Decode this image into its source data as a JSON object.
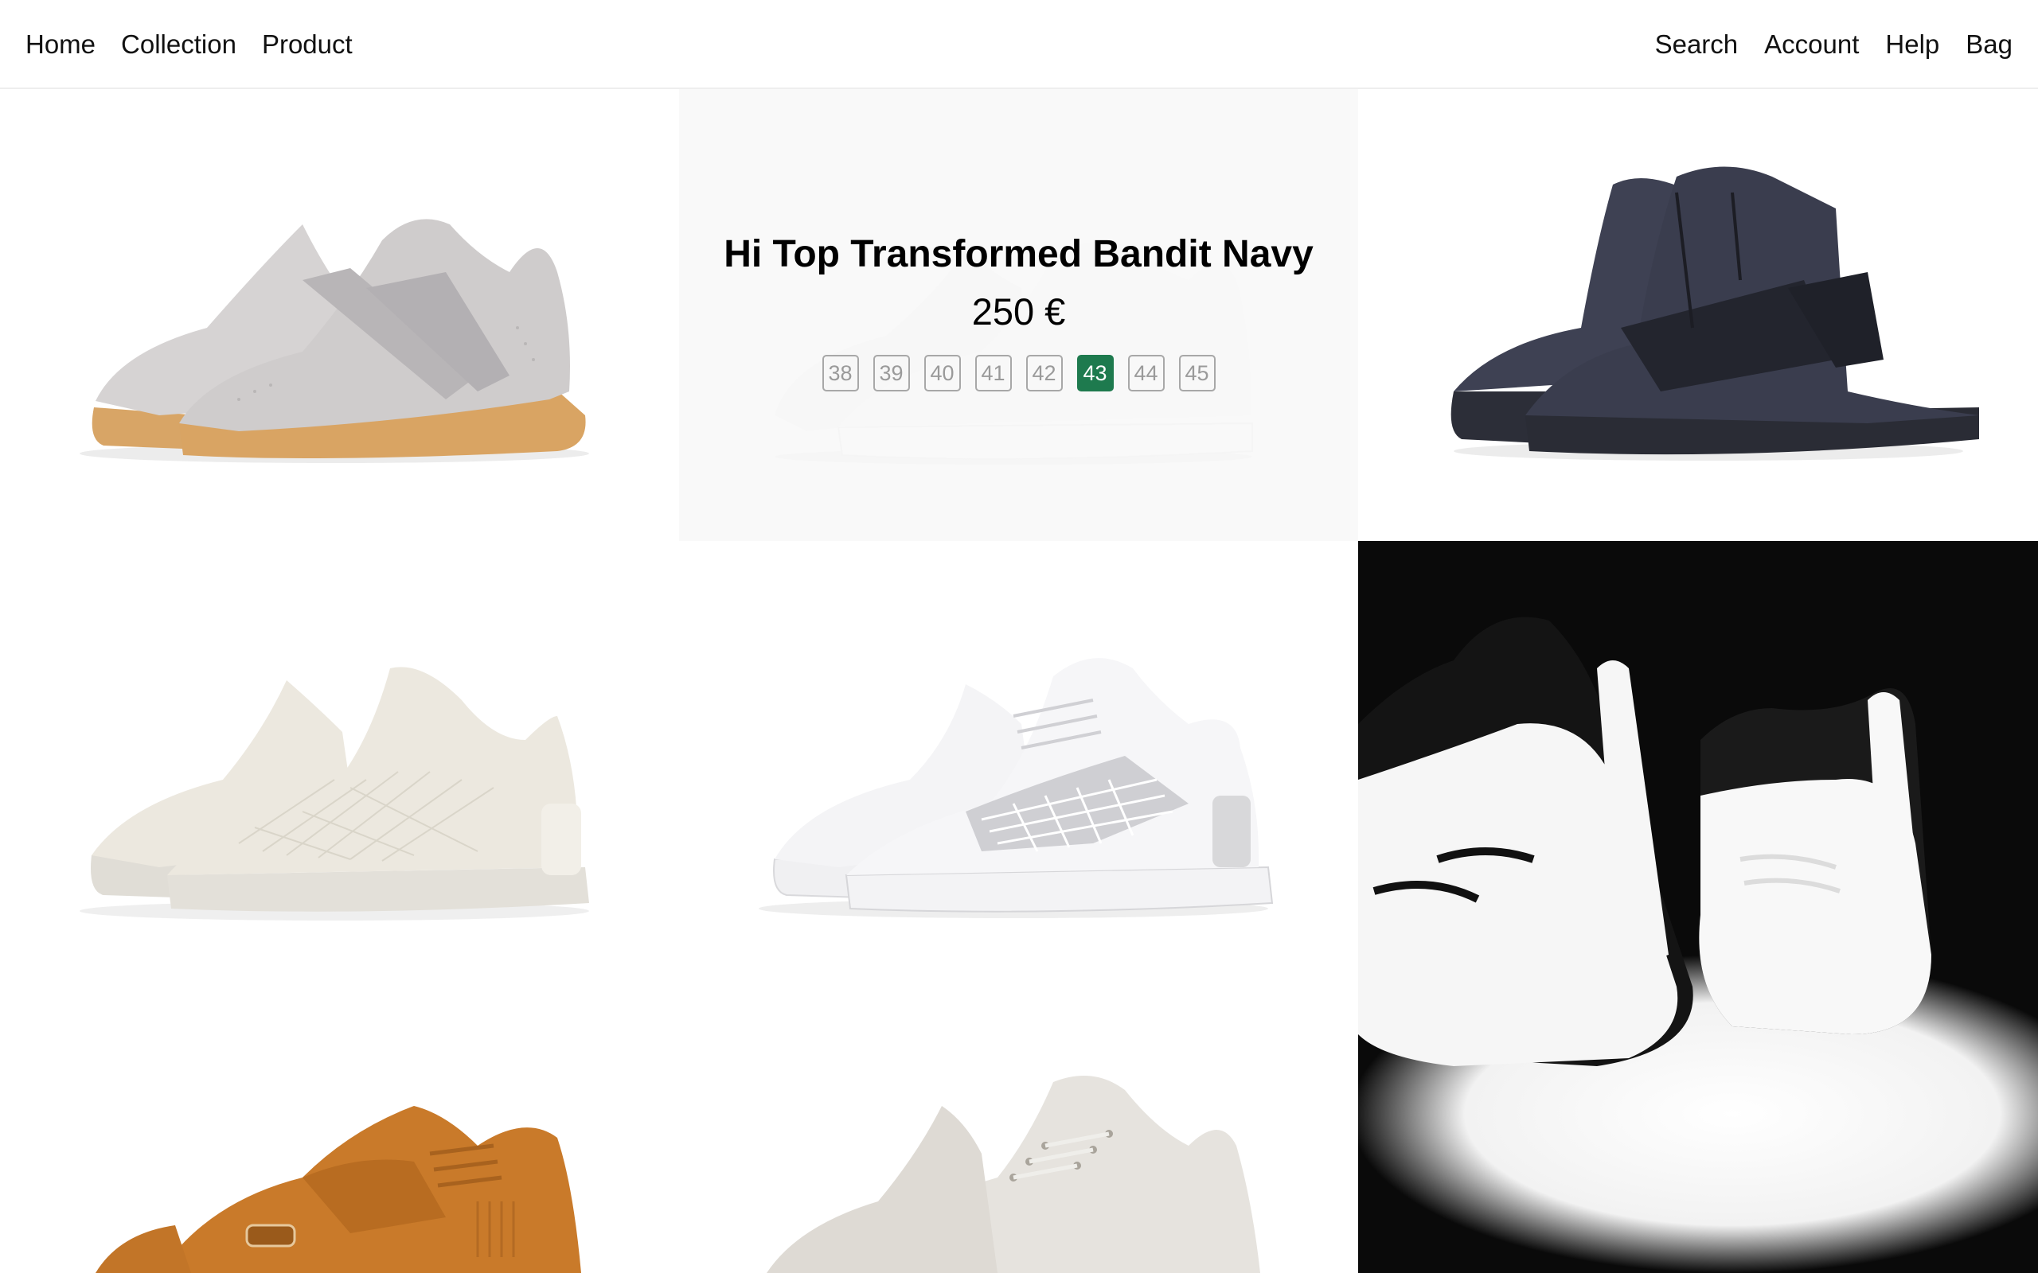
{
  "nav": {
    "left": [
      "Home",
      "Collection",
      "Product"
    ],
    "right": [
      "Search",
      "Account",
      "Help",
      "Bag"
    ]
  },
  "featured": {
    "title": "Hi Top Transformed Bandit Navy",
    "price": "250 €",
    "sizes": [
      "38",
      "39",
      "40",
      "41",
      "42",
      "43",
      "44",
      "45"
    ],
    "selected_size": "43",
    "accent_color": "#1e7a4e"
  },
  "grid_colors": {
    "tile_1": "#cfcccc",
    "tile_2": "#f1f1f1",
    "tile_3": "#3a3d4e",
    "tile_4": "#ece8df",
    "tile_5": "#f4f4f6",
    "tile_6": "#f6f6f6",
    "tile_7": "#c97a2a",
    "tile_8": "#e6e3de"
  }
}
